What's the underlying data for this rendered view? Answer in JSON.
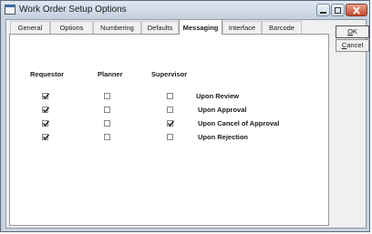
{
  "window": {
    "title": "Work Order Setup Options"
  },
  "tabs": [
    {
      "label": "General"
    },
    {
      "label": "Options"
    },
    {
      "label": "Numbering"
    },
    {
      "label": "Defaults"
    },
    {
      "label": "Messaging",
      "selected": true
    },
    {
      "label": "Interface"
    },
    {
      "label": "Barcode"
    }
  ],
  "columns": {
    "requestor": "Requestor",
    "planner": "Planner",
    "supervisor": "Supervisor"
  },
  "rows": [
    {
      "label": "Upon Review",
      "requestor": true,
      "planner": false,
      "supervisor": false
    },
    {
      "label": "Upon Approval",
      "requestor": true,
      "planner": false,
      "supervisor": false
    },
    {
      "label": "Upon Cancel of Approval",
      "requestor": true,
      "planner": false,
      "supervisor": true
    },
    {
      "label": "Upon Rejection",
      "requestor": true,
      "planner": false,
      "supervisor": false
    }
  ],
  "buttons": {
    "ok_mnemonic": "O",
    "ok_rest": "K",
    "cancel_mnemonic": "C",
    "cancel_rest": "ancel"
  }
}
